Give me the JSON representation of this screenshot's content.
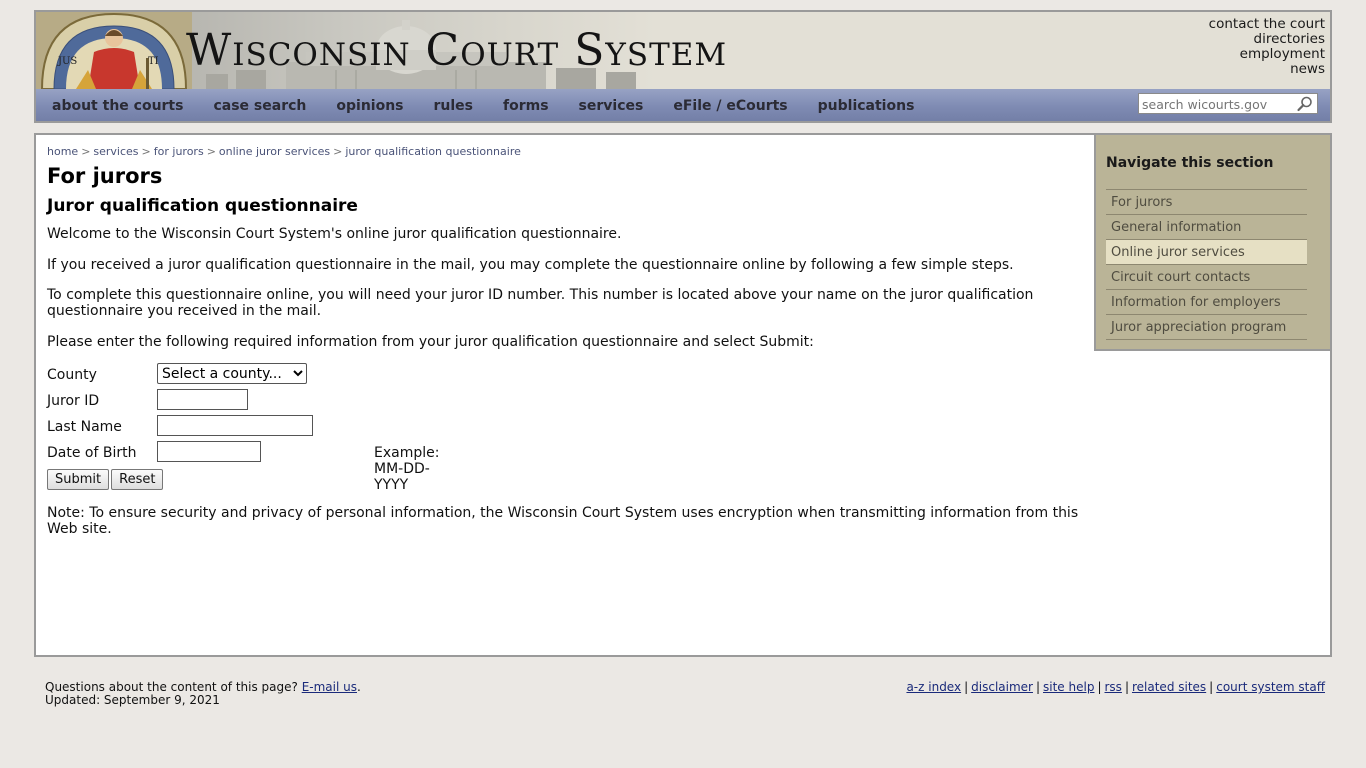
{
  "header": {
    "title": "Wisconsin Court System",
    "utility_links": [
      "contact the court",
      "directories",
      "employment",
      "news"
    ]
  },
  "nav": {
    "items": [
      "about the courts",
      "case search",
      "opinions",
      "rules",
      "forms",
      "services",
      "eFile / eCourts",
      "publications"
    ],
    "search_placeholder": "search wicourts.gov"
  },
  "breadcrumb": [
    "home",
    "services",
    "for jurors",
    "online juror services",
    "juror qualification questionnaire"
  ],
  "breadcrumb_separator": ">",
  "main": {
    "title": "For jurors",
    "subtitle": "Juror qualification questionnaire",
    "paragraphs": {
      "welcome": "Welcome to the Wisconsin Court System's online juror qualification questionnaire.",
      "received": "If you received a juror qualification questionnaire in the mail, you may complete the questionnaire online by following a few simple steps.",
      "complete": "To complete this questionnaire online, you will need your juror ID number. This number is located above your name on the juror qualification questionnaire you received in the mail.",
      "enter": "Please enter the following required information from your juror qualification questionnaire and select Submit:",
      "note": "Note: To ensure security and privacy of personal information, the Wisconsin Court System uses encryption when transmitting information from this Web site."
    },
    "form": {
      "county_label": "County",
      "county_selected": "Select a county...",
      "juror_id_label": "Juror ID",
      "last_name_label": "Last Name",
      "dob_label": "Date of Birth",
      "dob_example": "Example: MM-DD-YYYY",
      "submit_label": "Submit",
      "reset_label": "Reset"
    }
  },
  "section_nav": {
    "title": "Navigate this section",
    "items": [
      "For jurors",
      "General information",
      "Online juror services",
      "Circuit court contacts",
      "Information for employers",
      "Juror appreciation program"
    ],
    "active_item": "Online juror services"
  },
  "footer": {
    "question_text": "Questions about the content of this page?",
    "email_link": "E-mail us",
    "updated": "Updated: September 9, 2021",
    "links": [
      "a-z index",
      "disclaimer",
      "site help",
      "rss",
      "related sites",
      "court system staff"
    ],
    "link_separator": "|"
  },
  "colors": {
    "page_bg": "#ebe8e4",
    "nav_bar": "#7f8bb3",
    "section_nav_bg": "#bab497",
    "section_nav_active": "#e6e0c4",
    "link": "#1a2a7a"
  }
}
